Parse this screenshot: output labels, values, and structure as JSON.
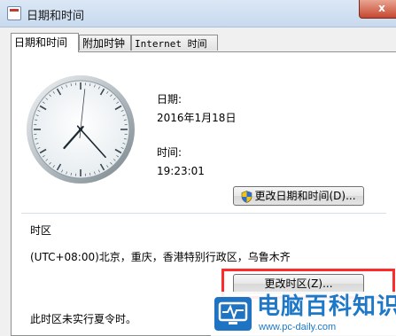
{
  "window": {
    "title": "日期和时间",
    "close_label": "x"
  },
  "tabs": [
    {
      "label": "日期和时间",
      "active": true
    },
    {
      "label": "附加时钟",
      "active": false
    },
    {
      "label": "Internet 时间",
      "active": false
    }
  ],
  "date_section": {
    "date_label": "日期:",
    "date_value": "2016年1月18日",
    "time_label": "时间:",
    "time_value": "19:23:01",
    "change_datetime_button": "更改日期和时间(D)..."
  },
  "timezone_section": {
    "heading": "时区",
    "value": "(UTC+08:00)北京，重庆，香港特别行政区，乌鲁木齐",
    "change_timezone_button": "更改时区(Z)...",
    "dst_note": "此时区未实行夏令时。"
  },
  "clock": {
    "hour": 19,
    "minute": 23,
    "second": 1
  },
  "watermark": {
    "text": "电脑百科知识",
    "url": "www.pc-daily.com"
  },
  "colors": {
    "highlight": "#ff2a2a",
    "watermark": "#1d78c8"
  }
}
